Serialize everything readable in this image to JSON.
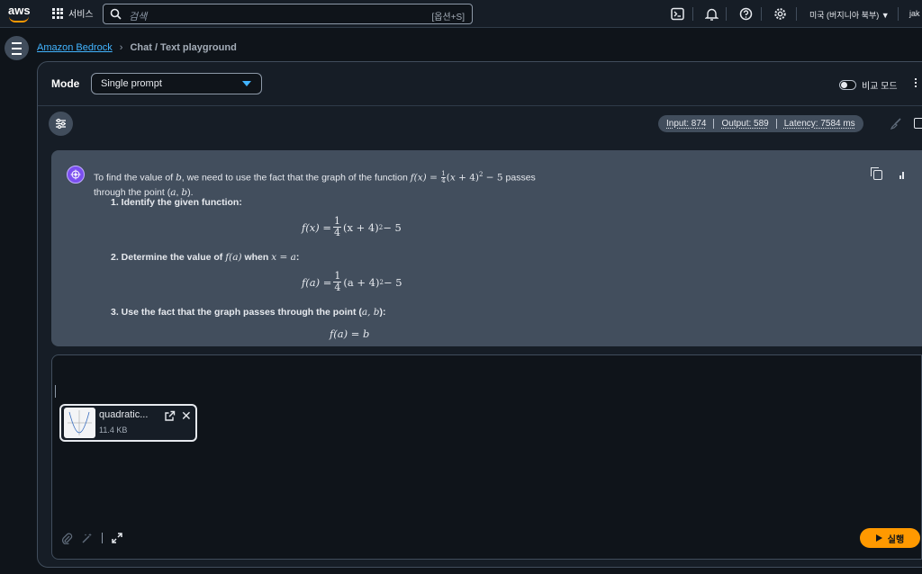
{
  "topbar": {
    "logo_text": "aws",
    "services_label": "서비스",
    "search_placeholder": "검색",
    "search_shortcut": "[옵션+S]",
    "region": "미국 (버지니아 북부) ▼",
    "user": "jak"
  },
  "breadcrumb": {
    "link": "Amazon Bedrock",
    "current": "Chat / Text playground"
  },
  "mode": {
    "label": "Mode",
    "selected": "Single prompt",
    "compare_label": "비교 모드"
  },
  "metrics": {
    "input": "Input: 874",
    "output": "Output: 589",
    "latency": "Latency: 7584 ms"
  },
  "response": {
    "intro_a": "To find the value of ",
    "var_b": "b",
    "intro_b": ", we need to use the fact that the graph of the function ",
    "intro_c": " passes",
    "intro_line2": "through the point (",
    "point_a": "a",
    "point_sep": ", ",
    "point_b": "b",
    "intro_end": ").",
    "step1": "1. Identify the given function:",
    "step2_a": "2. Determine the value of ",
    "step2_b": " when ",
    "step3_a": "3. Use the fact that the graph passes through the point (",
    "step3_b": "):",
    "eq1_lhs": "f(x) =",
    "eq1_rhs": "(x + 4)",
    "eq2_lhs": "f(a) =",
    "eq2_rhs": "(a + 4)",
    "eq3": "f(a) = b",
    "frac_num": "1",
    "frac_den": "4",
    "exp": "2",
    "tail": " − 5",
    "fx": "f(x)",
    "fa": "f(a)",
    "xeqa": "x = a",
    "ab": "a, b",
    "x_var": "x",
    "a_var": "a"
  },
  "attachment": {
    "name": "quadratic...",
    "size": "11.4 KB"
  },
  "run_label": "실행"
}
